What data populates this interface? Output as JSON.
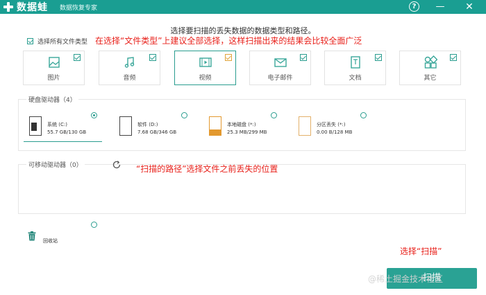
{
  "window": {
    "app_name": "数据蛙",
    "subtitle": "数据恢复专家",
    "help_icon": "help-icon",
    "minimize_icon": "minimize-icon",
    "close_icon": "close-icon"
  },
  "heading": "选择要扫描的丢失数据的数据类型和路径。",
  "select_all": {
    "label": "选择所有文件类型",
    "checked": true
  },
  "annotations": {
    "file_types": "在选择“文件类型”上建议全部选择，这样扫描出来的结果会比较全面广泛",
    "path": "“扫描的路径”选择文件之前丢失的位置",
    "scan": "选择“扫描”"
  },
  "file_types": [
    {
      "name": "图片",
      "icon": "image-icon",
      "checked": true,
      "active": false
    },
    {
      "name": "音频",
      "icon": "music-icon",
      "checked": true,
      "active": false
    },
    {
      "name": "视频",
      "icon": "video-icon",
      "checked": true,
      "active": true
    },
    {
      "name": "电子邮件",
      "icon": "email-icon",
      "checked": true,
      "active": false
    },
    {
      "name": "文档",
      "icon": "document-icon",
      "checked": true,
      "active": false
    },
    {
      "name": "其它",
      "icon": "other-icon",
      "checked": true,
      "active": false
    }
  ],
  "disk_section": {
    "title": "硬盘驱动器（4）",
    "drives": [
      {
        "name": "系统 (C:)",
        "size": "55.7 GB/130 GB",
        "selected": true,
        "fill_fraction": 0.43
      },
      {
        "name": "软件 (D:)",
        "size": "7.68 GB/346 GB",
        "selected": false,
        "fill_fraction": 0.02
      },
      {
        "name": "本地磁盘 (*:)",
        "size": "25.3 MB/299 MB",
        "selected": false,
        "fill_fraction": 0.6
      },
      {
        "name": "分区丢失 (*:)",
        "size": "0.00  B/128 MB",
        "selected": false,
        "fill_fraction": 0.0
      }
    ]
  },
  "removable_section": {
    "title": "可移动驱动器（0）",
    "refresh_icon": "refresh-icon"
  },
  "recycle_bin": {
    "label": "回收站",
    "icon": "trash-icon",
    "selected": false
  },
  "scan_button": {
    "label": "扫描"
  },
  "watermark": "@稀土掘金技术社区",
  "colors": {
    "accent": "#2aa294",
    "titlebar": "#1a9e92",
    "annotation": "#e8201a",
    "active_check": "#e0a43a"
  }
}
